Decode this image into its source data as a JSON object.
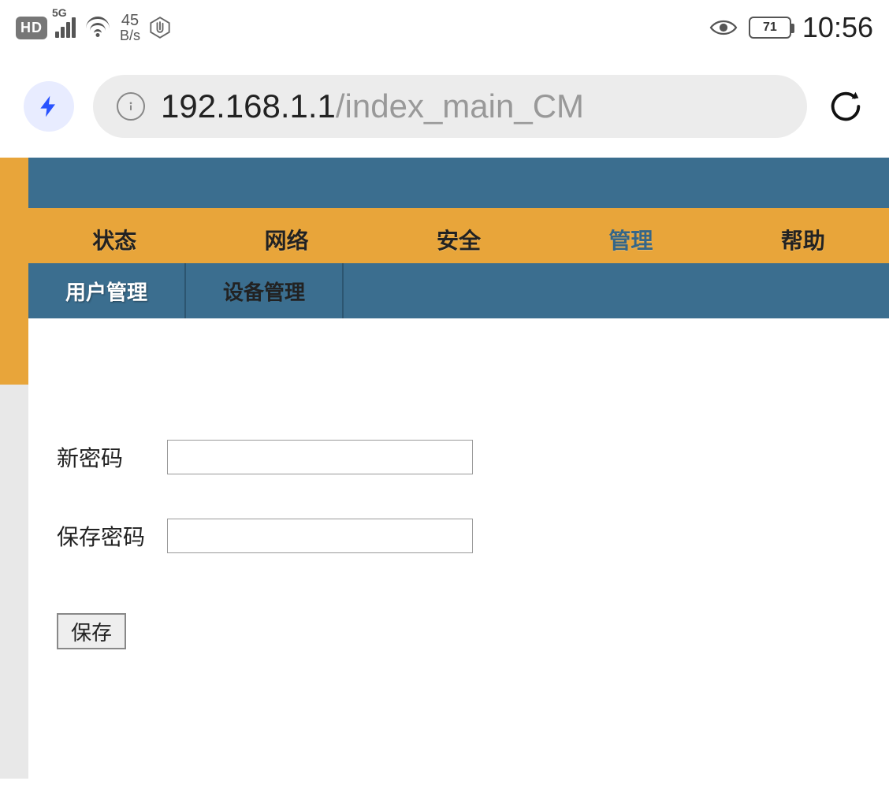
{
  "status_bar": {
    "hd_label": "HD",
    "network_label": "5G",
    "speed_value": "45",
    "speed_unit": "B/s",
    "battery_level": "71",
    "time": "10:56"
  },
  "browser": {
    "url_host": "192.168.1.1",
    "url_path": "/index_main_CM"
  },
  "nav": {
    "main_tabs": [
      {
        "label": "状态"
      },
      {
        "label": "网络"
      },
      {
        "label": "安全"
      },
      {
        "label": "管理",
        "active": true
      },
      {
        "label": "帮助"
      }
    ],
    "sub_tabs": [
      {
        "label": "用户管理",
        "active": true
      },
      {
        "label": "设备管理"
      }
    ]
  },
  "form": {
    "new_password_label": "新密码",
    "new_password_value": "",
    "confirm_password_label": "保存密码",
    "confirm_password_value": "",
    "save_button_label": "保存"
  }
}
